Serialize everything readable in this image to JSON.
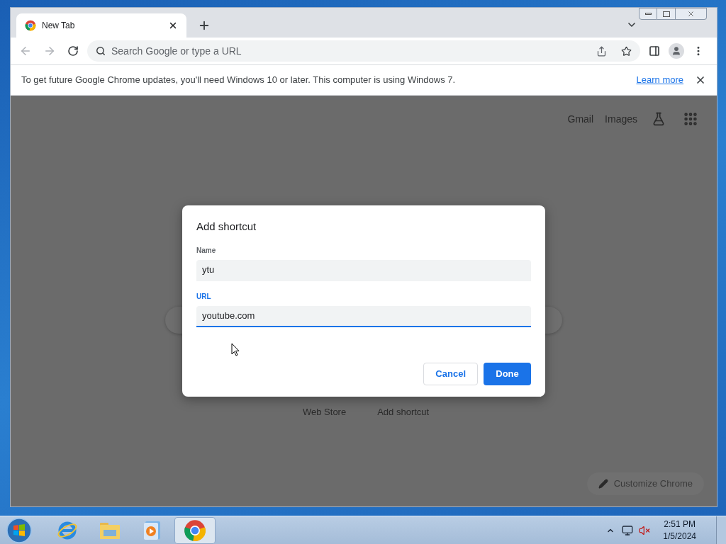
{
  "window": {
    "tab": {
      "title": "New Tab"
    },
    "omnibox": {
      "placeholder": "Search Google or type a URL"
    },
    "infobar": {
      "message": "To get future Google Chrome updates, you'll need Windows 10 or later. This computer is using Windows 7.",
      "link": "Learn more"
    }
  },
  "page": {
    "top_links": [
      "Gmail",
      "Images"
    ],
    "shortcuts": [
      "Web Store",
      "Add shortcut"
    ],
    "customize_button": "Customize Chrome"
  },
  "dialog": {
    "title": "Add shortcut",
    "fields": [
      {
        "label": "Name",
        "value": "ytu",
        "focused": false
      },
      {
        "label": "URL",
        "value": "youtube.com",
        "focused": true
      }
    ],
    "buttons": [
      {
        "label": "Cancel",
        "kind": "secondary"
      },
      {
        "label": "Done",
        "kind": "primary"
      }
    ]
  },
  "taskbar": {
    "apps": [
      {
        "kind": "browser-e",
        "selected": false
      },
      {
        "kind": "folder",
        "selected": false
      },
      {
        "kind": "media",
        "selected": false
      },
      {
        "kind": "chrome",
        "selected": true
      }
    ],
    "clock": {
      "time": "2:51 PM",
      "date": "1/5/2024"
    }
  }
}
